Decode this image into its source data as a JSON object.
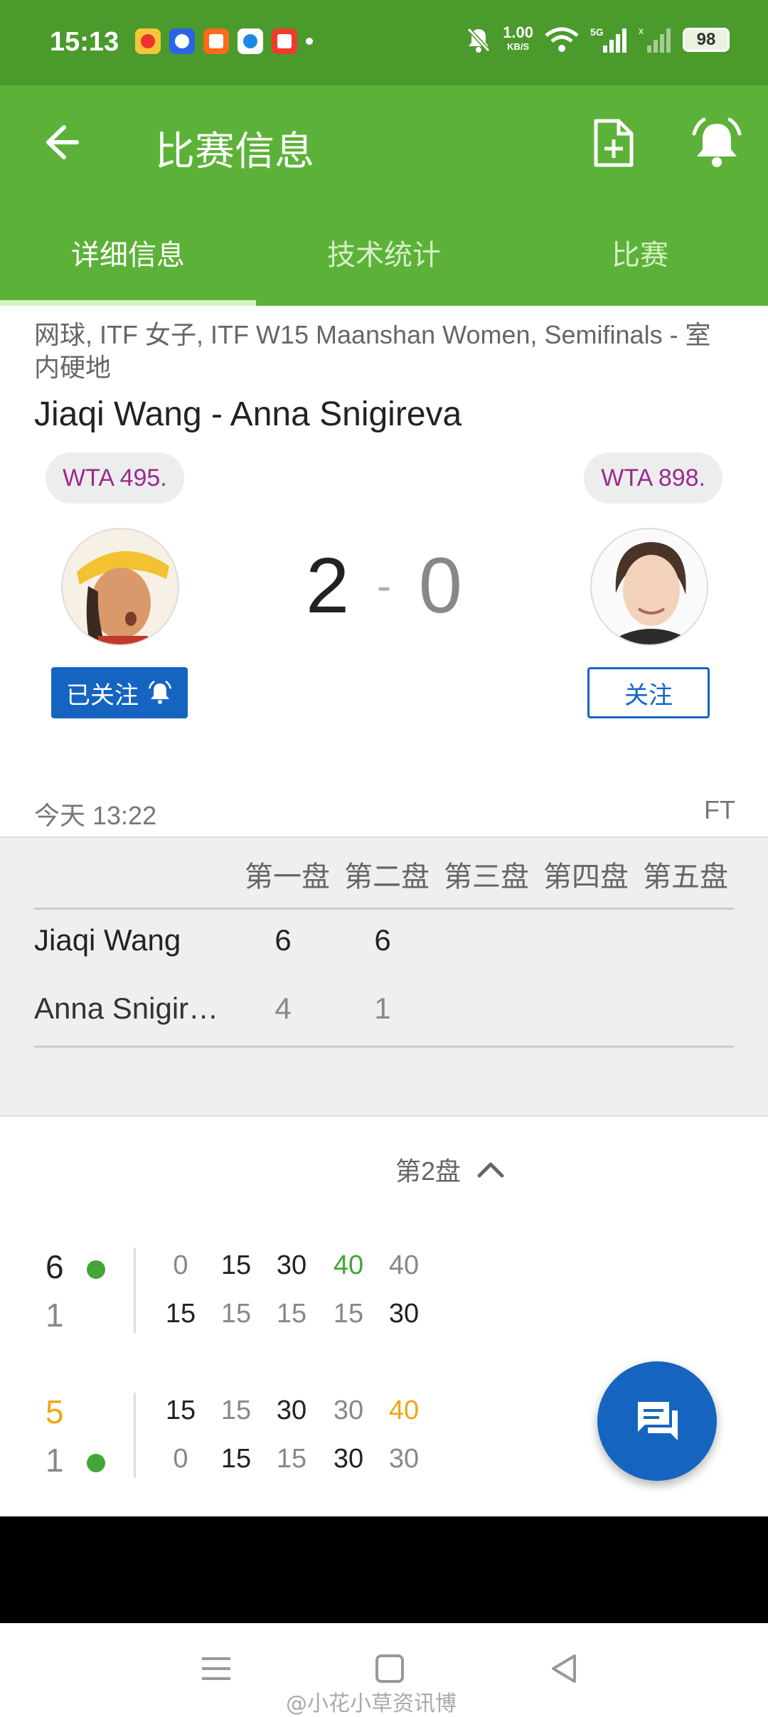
{
  "status_bar": {
    "time": "15:13",
    "net_speed_value": "1.00",
    "net_speed_unit": "KB/S",
    "battery": "98",
    "icons": [
      "weibo-icon",
      "baidu-icon",
      "taobao-icon",
      "qq-browser-icon",
      "app-icon",
      "mute-icon",
      "wifi-icon",
      "5g-signal-icon",
      "signal-icon",
      "battery-icon"
    ]
  },
  "app_bar": {
    "title": "比赛信息",
    "actions": [
      "add-file-icon",
      "alarm-bell-icon"
    ]
  },
  "tabs": [
    {
      "label": "详细信息",
      "active": true
    },
    {
      "label": "技术统计",
      "active": false
    },
    {
      "label": "比赛",
      "active": false
    }
  ],
  "match": {
    "league": "网球, ITF 女子, ITF W15 Maanshan Women, Semifinals - 室内硬地",
    "title": "Jiaqi Wang - Anna Snigireva",
    "home": {
      "rank": "WTA 495.",
      "follow_label": "已关注",
      "followed": true
    },
    "away": {
      "rank": "WTA 898.",
      "follow_label": "关注",
      "followed": false
    },
    "score_home": "2",
    "score_separator": "-",
    "score_away": "0",
    "time": "今天 13:22",
    "status": "FT"
  },
  "sets_table": {
    "headers": [
      "第一盘",
      "第二盘",
      "第三盘",
      "第四盘",
      "第五盘"
    ],
    "rows": [
      {
        "name": "Jiaqi Wang",
        "scores": [
          "6",
          "6"
        ]
      },
      {
        "name": "Anna Snigireva",
        "scores": [
          "4",
          "1"
        ]
      }
    ]
  },
  "point_by_point": {
    "set_label": "第2盘",
    "games": [
      {
        "top": {
          "score": "6",
          "serving": true,
          "points": [
            "0",
            "15",
            "30",
            "40",
            "40"
          ]
        },
        "bottom": {
          "score": "1",
          "serving": false,
          "points": [
            "15",
            "15",
            "15",
            "15",
            "30"
          ]
        }
      },
      {
        "top": {
          "score": "5",
          "serving": false,
          "points": [
            "15",
            "15",
            "30",
            "30",
            "40"
          ]
        },
        "bottom": {
          "score": "1",
          "serving": true,
          "points": [
            "0",
            "15",
            "15",
            "30",
            "30"
          ]
        }
      }
    ]
  },
  "colors": {
    "status_bar": "#4a9a2c",
    "app_bar": "#5cb238",
    "accent_blue": "#1565c0",
    "rank_text": "#9b2a8e",
    "serve_dot": "#43a535",
    "highlight_green": "#43a535",
    "highlight_orange": "#f2a516"
  },
  "watermark": "@小花小草资讯博"
}
